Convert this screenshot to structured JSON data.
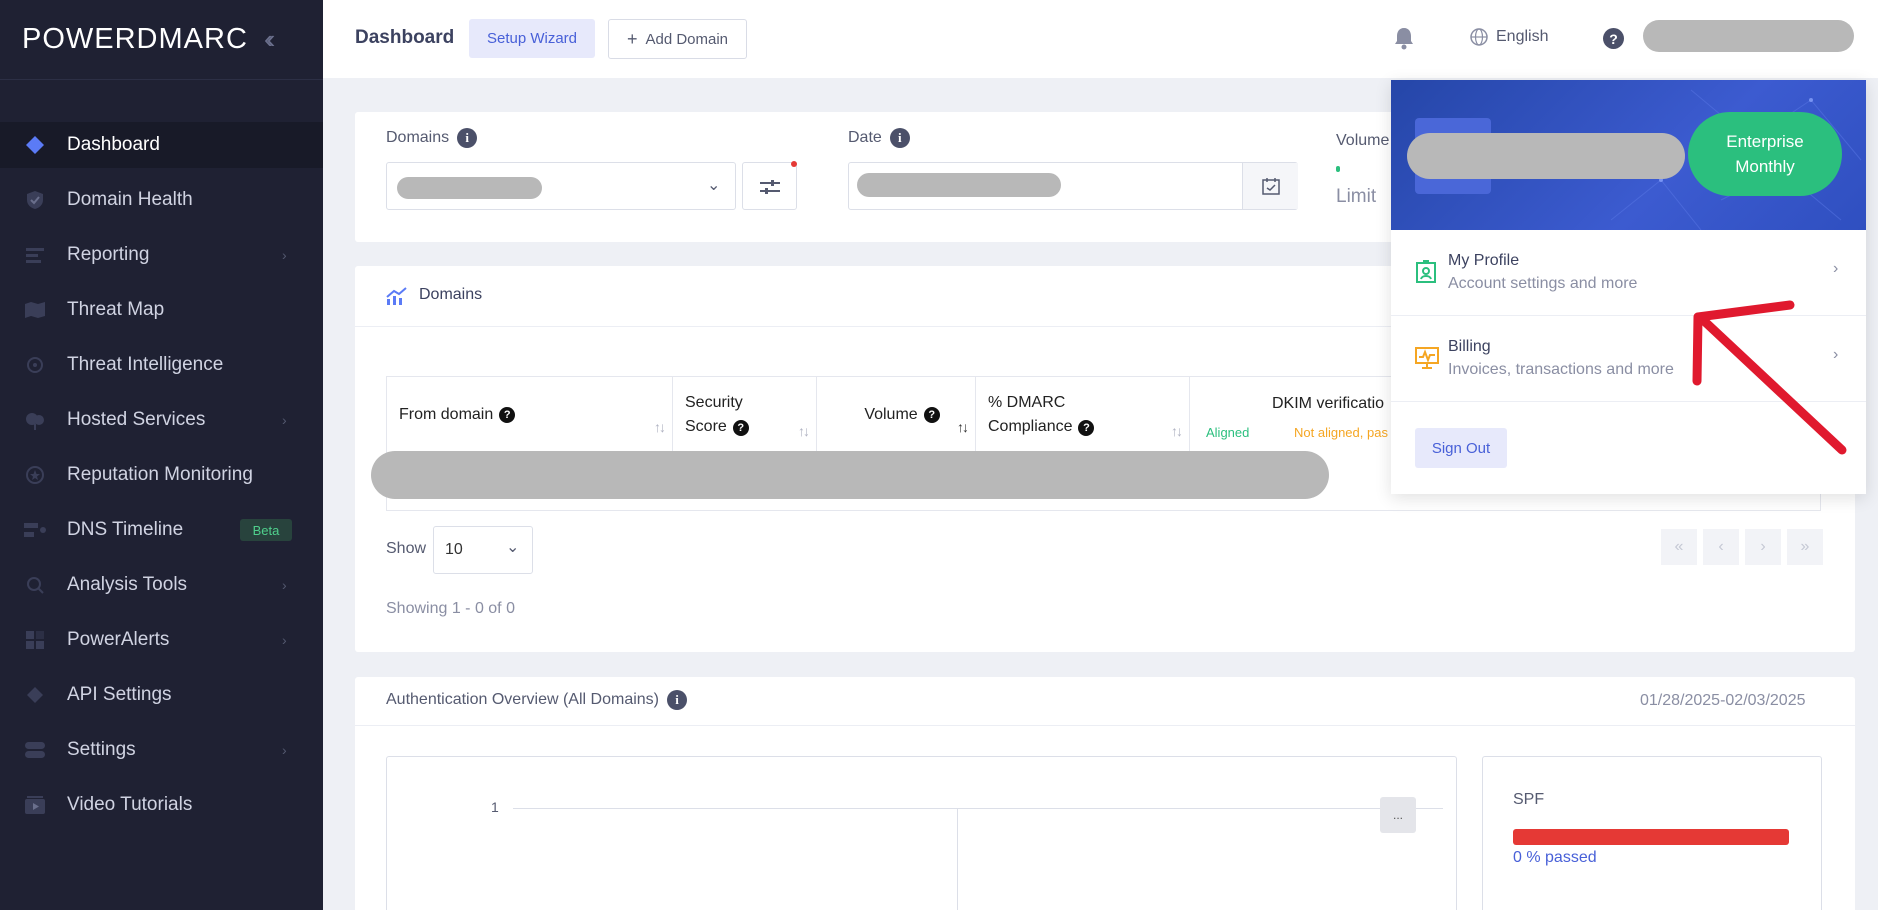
{
  "app": {
    "logo": "POWERDMARC"
  },
  "sidebar": {
    "items": [
      {
        "label": "Dashboard",
        "icon": "diamond-icon"
      },
      {
        "label": "Domain Health",
        "icon": "shield-check-icon"
      },
      {
        "label": "Reporting",
        "icon": "list-icon"
      },
      {
        "label": "Threat Map",
        "icon": "map-icon"
      },
      {
        "label": "Threat Intelligence",
        "icon": "radar-icon"
      },
      {
        "label": "Hosted Services",
        "icon": "cloud-icon"
      },
      {
        "label": "Reputation Monitoring",
        "icon": "star-icon"
      },
      {
        "label": "DNS Timeline",
        "icon": "timeline-icon",
        "badge": "Beta"
      },
      {
        "label": "Analysis Tools",
        "icon": "search-icon"
      },
      {
        "label": "PowerAlerts",
        "icon": "grid-icon"
      },
      {
        "label": "API Settings",
        "icon": "api-icon"
      },
      {
        "label": "Settings",
        "icon": "toggle-icon"
      },
      {
        "label": "Video Tutorials",
        "icon": "video-icon"
      }
    ]
  },
  "topbar": {
    "title": "Dashboard",
    "setup_wizard": "Setup Wizard",
    "add_domain": "Add Domain",
    "language": "English",
    "help": "?"
  },
  "filters": {
    "domains_label": "Domains",
    "date_label": "Date",
    "volume_label": "Volume",
    "limit_label": "Limit"
  },
  "domains_table": {
    "title": "Domains",
    "columns": [
      {
        "line1": "From domain",
        "line2": ""
      },
      {
        "line1": "Security",
        "line2": "Score"
      },
      {
        "line1": "Volume",
        "line2": ""
      },
      {
        "line1": "% DMARC",
        "line2": "Compliance"
      },
      {
        "line1": "DKIM verificatio",
        "line2": ""
      }
    ],
    "dkim_aligned": "Aligned",
    "dkim_not_aligned": "Not aligned, pas",
    "show_label": "Show",
    "page_size": "10",
    "showing": "Showing 1 - 0 of 0"
  },
  "auth_overview": {
    "title": "Authentication Overview (All Domains)",
    "date_range": "01/28/2025-02/03/2025",
    "tick_label": "1",
    "more_button": "..."
  },
  "spf": {
    "title": "SPF",
    "passed_text": "0 % passed",
    "bar_color": "#e53935"
  },
  "profile_menu": {
    "plan": [
      "Enterprise",
      "Monthly"
    ],
    "my_profile": "My Profile",
    "my_profile_sub": "Account settings and more",
    "billing": "Billing",
    "billing_sub": "Invoices, transactions and more",
    "sign_out": "Sign Out"
  },
  "colors": {
    "accent": "#4860d8",
    "sidebar_bg": "#1f2133",
    "success": "#2bbf7e",
    "annotation": "#e0192e"
  }
}
